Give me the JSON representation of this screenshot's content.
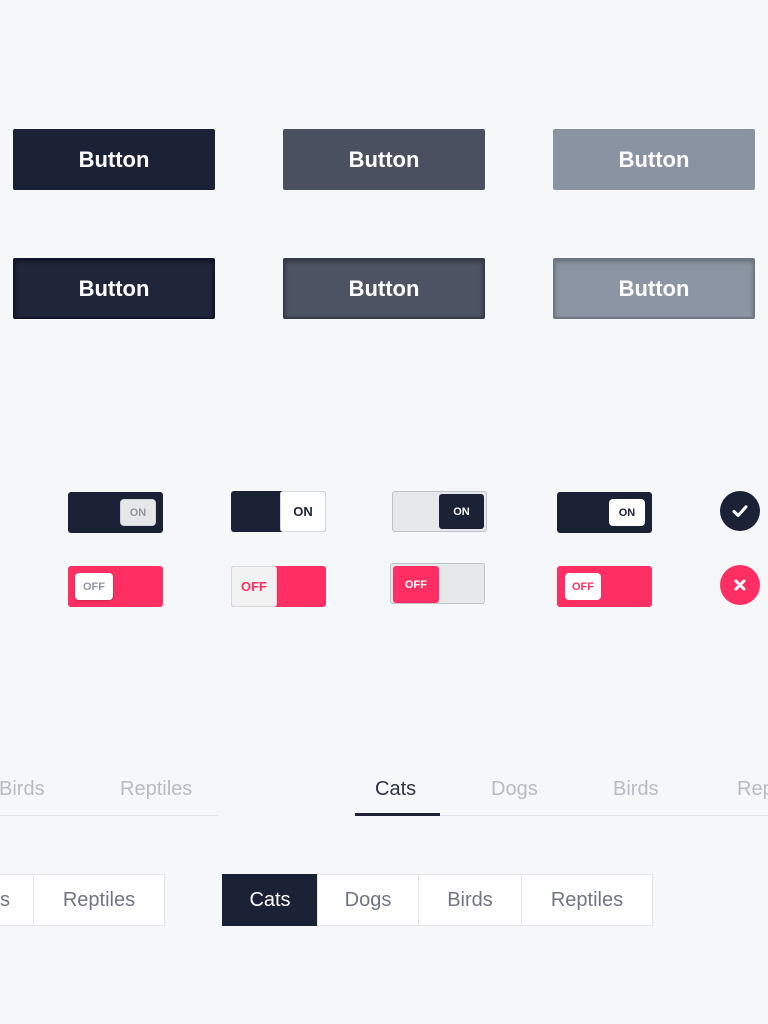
{
  "buttons": {
    "row1": [
      "Button",
      "Button",
      "Button"
    ],
    "row2": [
      "Button",
      "Button",
      "Button"
    ]
  },
  "toggles": {
    "on_label": "ON",
    "off_label": "OFF"
  },
  "icons": {
    "check": "check-icon",
    "close": "close-icon"
  },
  "tabs_underline": {
    "left_partial": [
      "Birds",
      "Reptiles"
    ],
    "right": [
      "Cats",
      "Dogs",
      "Birds",
      "Rep"
    ],
    "active": "Cats"
  },
  "tabs_segmented": {
    "left_partial": [
      "s",
      "Reptiles"
    ],
    "right": [
      "Cats",
      "Dogs",
      "Birds",
      "Reptiles"
    ],
    "active": "Cats"
  },
  "colors": {
    "navy": "#1c2236",
    "slate": "#4a5060",
    "gray": "#8a93a2",
    "pink": "#ff2f63",
    "background": "#f6f7f9"
  }
}
